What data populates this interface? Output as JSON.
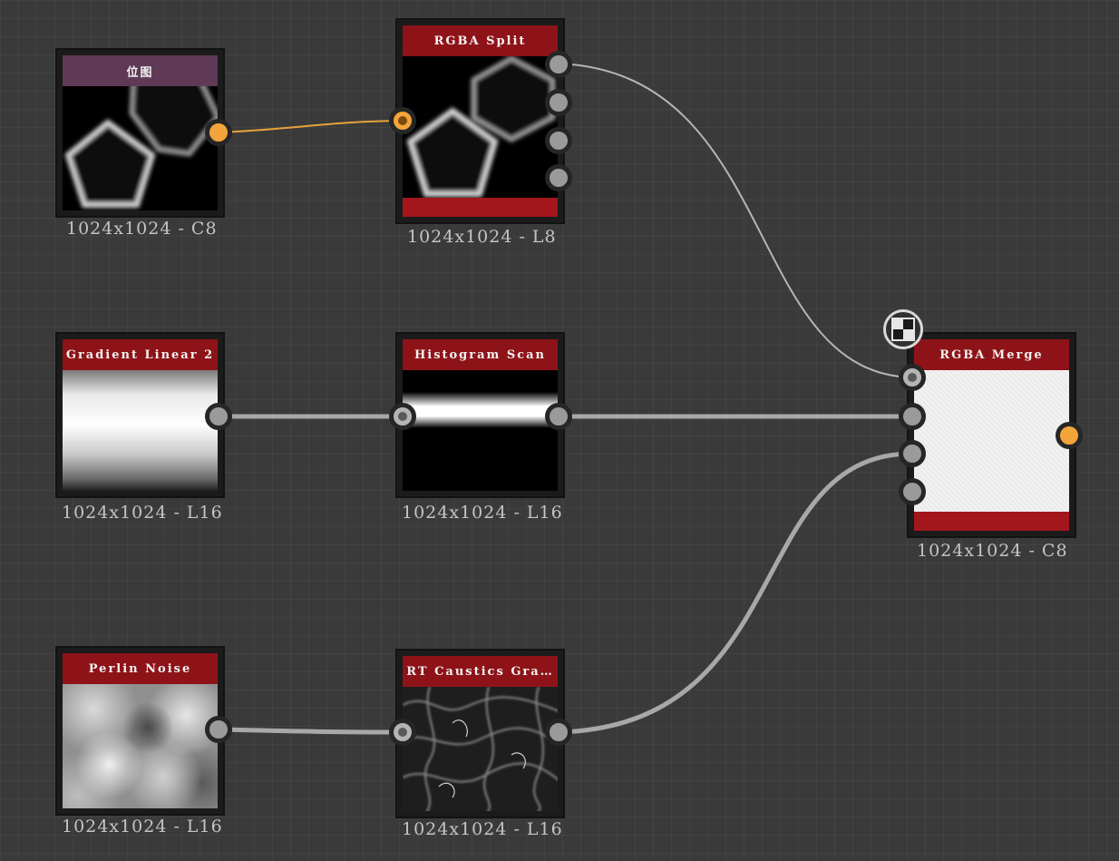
{
  "graph": {
    "nodes": {
      "bitmap": {
        "title": "位图",
        "resolution": "1024x1024 - C8"
      },
      "rgba_split": {
        "title": "RGBA Split",
        "resolution": "1024x1024 - L8"
      },
      "gradient": {
        "title": "Gradient Linear 2",
        "resolution": "1024x1024 - L16"
      },
      "histogram": {
        "title": "Histogram Scan",
        "resolution": "1024x1024 - L16"
      },
      "rgba_merge": {
        "title": "RGBA Merge",
        "resolution": "1024x1024 - C8"
      },
      "perlin": {
        "title": "Perlin Noise",
        "resolution": "1024x1024 - L16"
      },
      "caustics": {
        "title": "RT Caustics Gra…",
        "resolution": "1024x1024 - L16"
      }
    },
    "badge_icon": "checker-icon"
  },
  "colors": {
    "canvas_bg": "#3a3a3a",
    "node_title": "#8e1318",
    "bitmap_title": "#5e3a57",
    "color_port": "#f3a43a",
    "gray_port": "#9a9a9a",
    "wire_gray": "#a8a8a8",
    "wire_orange": "#e8a23c"
  }
}
